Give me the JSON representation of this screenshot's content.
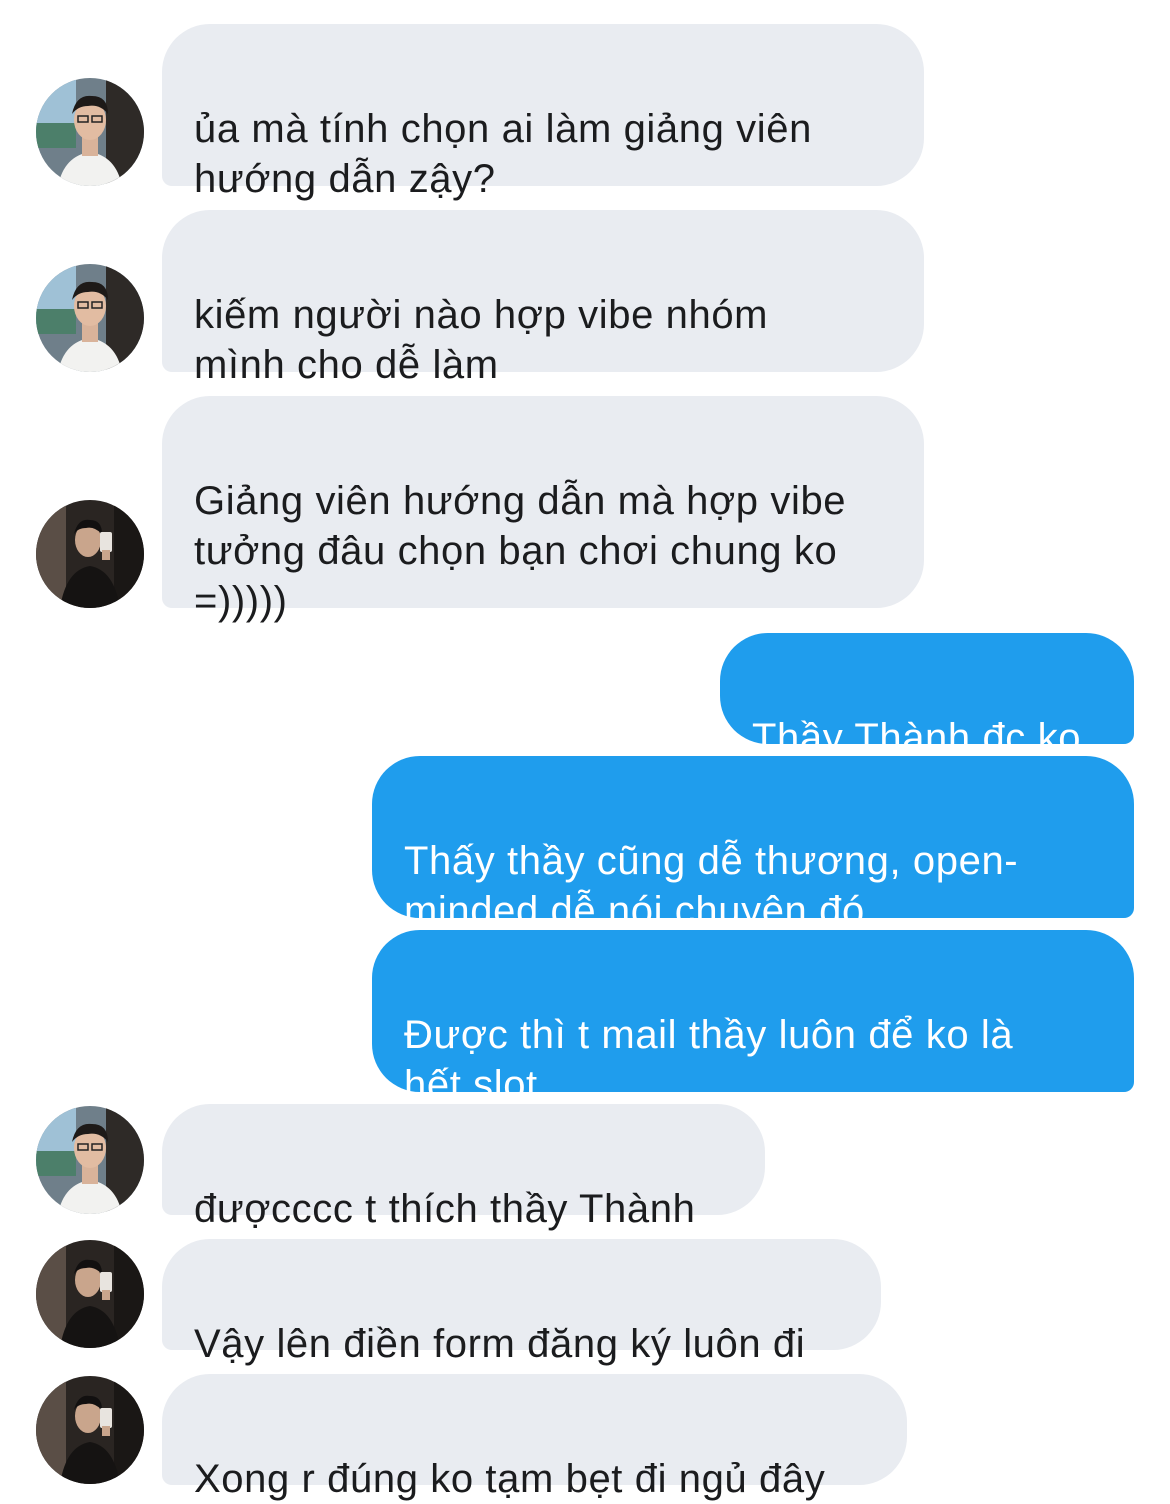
{
  "messages": [
    {
      "sender": "incoming",
      "avatar": "avatar-glasses-guy",
      "text": "ủa mà tính chọn ai làm giảng viên\nhướng dẫn zậy?"
    },
    {
      "sender": "incoming",
      "avatar": "avatar-glasses-guy",
      "text": "kiếm người nào hợp vibe nhóm\nmình cho dễ làm"
    },
    {
      "sender": "incoming",
      "avatar": "avatar-mirror-guy",
      "text": "Giảng viên hướng dẫn mà hợp vibe\ntưởng đâu chọn bạn chơi chung ko\n=)))))"
    },
    {
      "sender": "outgoing",
      "text": "Thầy Thành đc ko"
    },
    {
      "sender": "outgoing",
      "text": "Thấy thầy cũng dễ thương, open-\nminded dễ nói chuyện đó"
    },
    {
      "sender": "outgoing",
      "text": "Được thì t mail thầy luôn để ko là\nhết slot"
    },
    {
      "sender": "incoming",
      "avatar": "avatar-glasses-guy",
      "text": "đượcccc t thích thầy Thành"
    },
    {
      "sender": "incoming",
      "avatar": "avatar-mirror-guy",
      "text": "Vậy lên điền form đăng ký luôn đi"
    },
    {
      "sender": "incoming",
      "avatar": "avatar-mirror-guy",
      "text": "Xong r đúng ko tạm bẹt đi ngủ đây"
    }
  ],
  "colors": {
    "incoming_bubble": "#e9ecf1",
    "outgoing_bubble": "#1f9ded",
    "incoming_text": "#1b1c1e",
    "outgoing_text": "#ffffff"
  }
}
